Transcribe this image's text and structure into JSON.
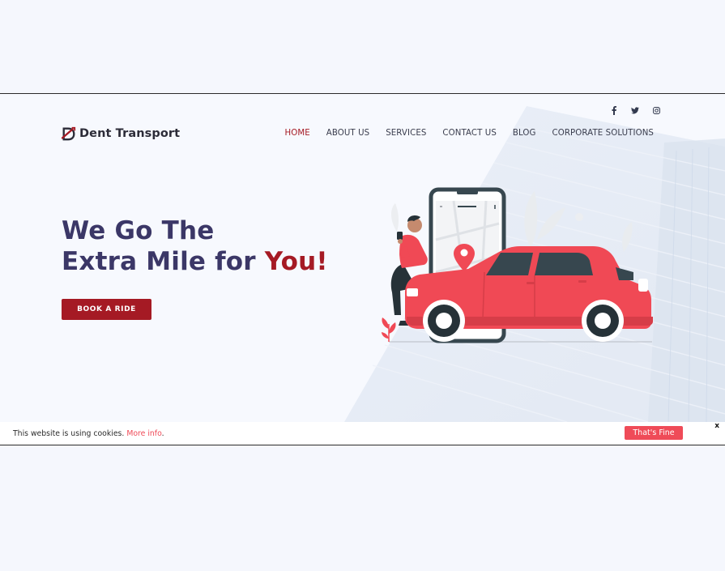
{
  "brand": {
    "name": "Dent Transport",
    "accent": "#a51a24",
    "primary_text": "#3b3767"
  },
  "social": [
    {
      "icon": "facebook-icon",
      "glyph": "f"
    },
    {
      "icon": "twitter-icon",
      "glyph": "🐦"
    },
    {
      "icon": "instagram-icon",
      "glyph": "◎"
    }
  ],
  "nav": {
    "items": [
      {
        "label": "HOME",
        "active": true
      },
      {
        "label": "ABOUT US"
      },
      {
        "label": "SERVICES"
      },
      {
        "label": "CONTACT US"
      },
      {
        "label": "BLOG"
      },
      {
        "label": "CORPORATE SOLUTIONS"
      }
    ]
  },
  "hero": {
    "line1": "We Go The",
    "line2": "Extra Mile for ",
    "accent": "You!",
    "cta": "BOOK A RIDE"
  },
  "cookie": {
    "text": "This website is using cookies. ",
    "link": "More info",
    "period": ".",
    "button": "That's Fine",
    "close": "x",
    "button_color": "#ef4b58"
  }
}
